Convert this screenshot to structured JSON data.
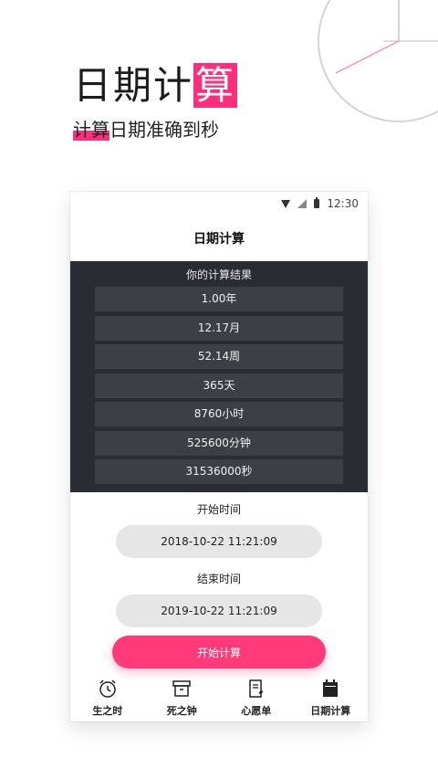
{
  "promo": {
    "title_prefix": "日期计",
    "title_highlight": "算",
    "subtitle_highlight": "计算",
    "subtitle_rest": "日期准确到秒"
  },
  "status_bar": {
    "time": "12:30"
  },
  "app": {
    "title": "日期计算"
  },
  "results": {
    "title": "你的计算结果",
    "rows": [
      "1.00年",
      "12.17月",
      "52.14周",
      "365天",
      "8760小时",
      "525600分钟",
      "31536000秒"
    ]
  },
  "start": {
    "label": "开始时间",
    "value": "2018-10-22 11:21:09"
  },
  "end": {
    "label": "结束时间",
    "value": "2019-10-22 11:21:09"
  },
  "action": {
    "calculate_label": "开始计算",
    "color": "#ff3a7b"
  },
  "tabs": [
    {
      "label": "生之时",
      "icon": "alarm-clock-icon"
    },
    {
      "label": "死之钟",
      "icon": "box-icon"
    },
    {
      "label": "心愿单",
      "icon": "wishlist-icon"
    },
    {
      "label": "日期计算",
      "icon": "calendar-icon"
    }
  ],
  "colors": {
    "accent": "#ff2e7a",
    "results_bg": "#2a2c33",
    "row_bg": "#3d3f47"
  }
}
